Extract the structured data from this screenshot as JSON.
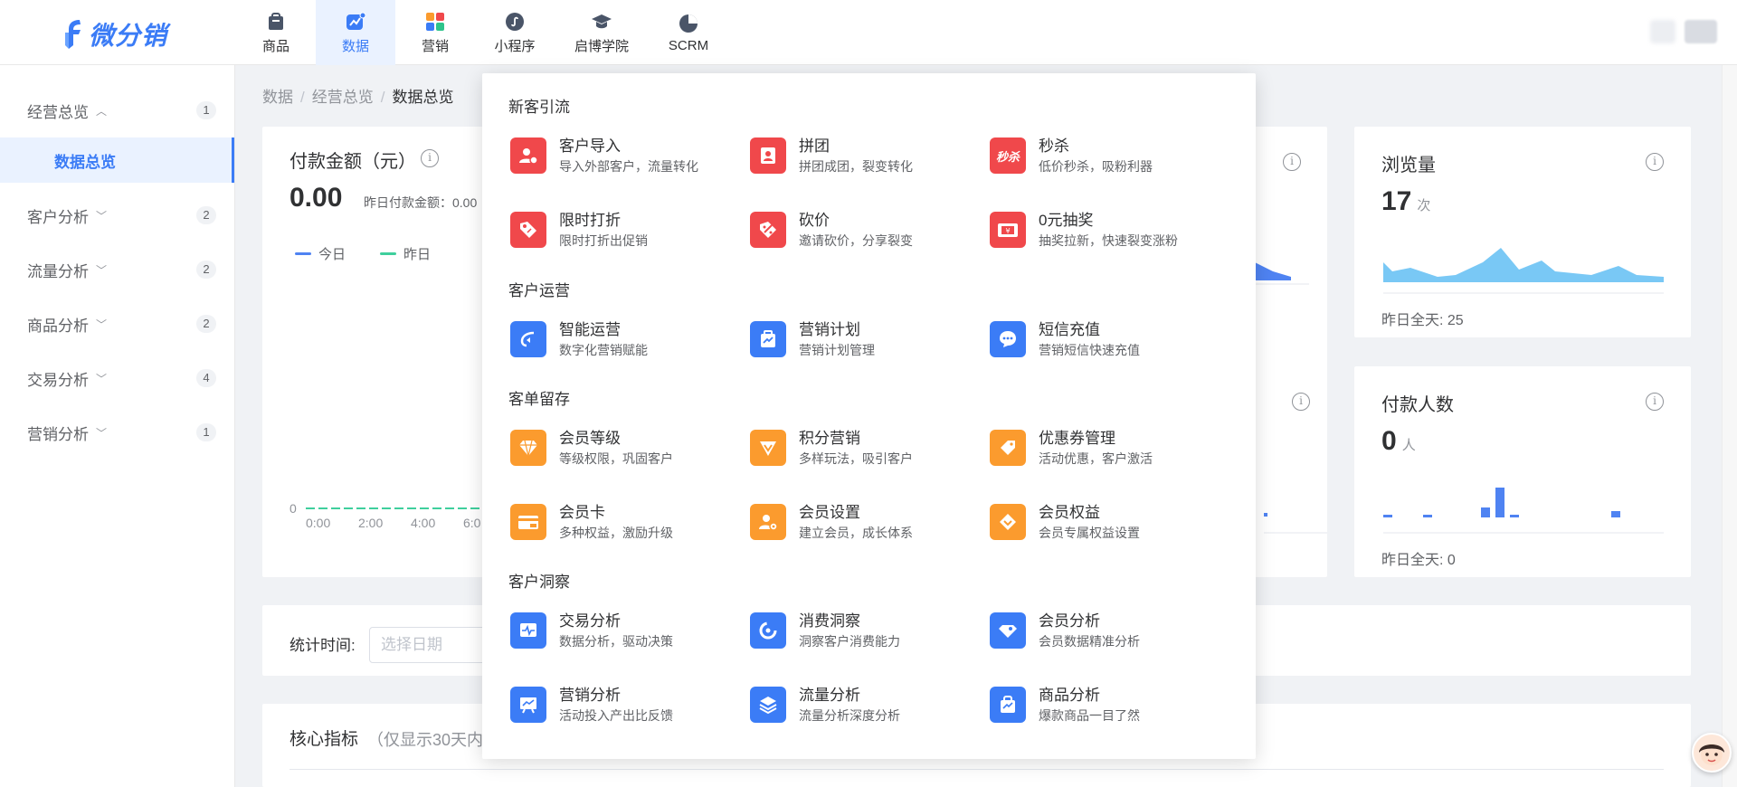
{
  "app": {
    "logo_text": "微分销"
  },
  "topnav": [
    {
      "label": "商品",
      "icon": "bag-icon"
    },
    {
      "label": "数据",
      "icon": "data-chart-icon"
    },
    {
      "label": "营销",
      "icon": "grid-apps-icon"
    },
    {
      "label": "小程序",
      "icon": "mini-program-icon"
    },
    {
      "label": "启博学院",
      "icon": "graduation-cap-icon"
    },
    {
      "label": "SCRM",
      "icon": "pie-icon"
    }
  ],
  "sidebar": {
    "groups": [
      {
        "label": "经营总览",
        "count": "1",
        "expanded": true
      },
      {
        "label": "客户分析",
        "count": "2"
      },
      {
        "label": "流量分析",
        "count": "2"
      },
      {
        "label": "商品分析",
        "count": "2"
      },
      {
        "label": "交易分析",
        "count": "4"
      },
      {
        "label": "营销分析",
        "count": "1"
      }
    ],
    "active_sub": "数据总览"
  },
  "breadcrumb": [
    "数据",
    "经营总览",
    "数据总览"
  ],
  "pay_card": {
    "title": "付款金额（元）",
    "value": "0.00",
    "yesterday": "昨日付款金额：0.00",
    "legend_today": "今日",
    "legend_yesterday": "昨日",
    "y_zero": "0",
    "x_ticks": [
      "0:00",
      "2:00",
      "4:00",
      "6:0"
    ]
  },
  "views_card": {
    "title": "浏览量",
    "value": "17",
    "unit": "次",
    "yesterday": "昨日全天:  25"
  },
  "payers_card": {
    "title": "付款人数",
    "value": "0",
    "unit": "人",
    "yesterday": "昨日全天:  0"
  },
  "stats_time": {
    "label": "统计时间:",
    "placeholder": "选择日期"
  },
  "core": {
    "title": "核心指标",
    "note": "（仅显示30天内"
  },
  "dropdown": {
    "sections": [
      {
        "title": "新客引流",
        "items": [
          {
            "name": "客户导入",
            "desc": "导入外部客户，流量转化",
            "icon": "customer-import-icon",
            "color": "#f0484b"
          },
          {
            "name": "拼团",
            "desc": "拼团成团，裂变转化",
            "icon": "group-buy-icon",
            "color": "#f0484b"
          },
          {
            "name": "秒杀",
            "desc": "低价秒杀，吸粉利器",
            "icon": "flash-sale-icon",
            "color": "#f0484b",
            "icon_text": "秒杀"
          },
          {
            "name": "限时打折",
            "desc": "限时打折出促销",
            "icon": "discount-tag-icon",
            "color": "#f0484b"
          },
          {
            "name": "砍价",
            "desc": "邀请砍价，分享裂变",
            "icon": "bargain-icon",
            "color": "#f0484b"
          },
          {
            "name": "0元抽奖",
            "desc": "抽奖拉新，快速裂变涨粉",
            "icon": "lottery-icon",
            "color": "#f0484b"
          }
        ]
      },
      {
        "title": "客户运营",
        "items": [
          {
            "name": "智能运营",
            "desc": "数字化营销赋能",
            "icon": "smart-ops-icon",
            "color": "#3b7cf6"
          },
          {
            "name": "营销计划",
            "desc": "营销计划管理",
            "icon": "marketing-plan-icon",
            "color": "#3b7cf6"
          },
          {
            "name": "短信充值",
            "desc": "营销短信快速充值",
            "icon": "sms-icon",
            "color": "#3b7cf6"
          }
        ]
      },
      {
        "title": "客单留存",
        "items": [
          {
            "name": "会员等级",
            "desc": "等级权限，巩固客户",
            "icon": "diamond-icon",
            "color": "#fb9b2e"
          },
          {
            "name": "积分营销",
            "desc": "多样玩法，吸引客户",
            "icon": "points-icon",
            "color": "#fb9b2e"
          },
          {
            "name": "优惠券管理",
            "desc": "活动优惠，客户激活",
            "icon": "coupon-icon",
            "color": "#fb9b2e"
          },
          {
            "name": "会员卡",
            "desc": "多种权益，激励升级",
            "icon": "vip-card-icon",
            "color": "#fb9b2e"
          },
          {
            "name": "会员设置",
            "desc": "建立会员，成长体系",
            "icon": "member-settings-icon",
            "color": "#fb9b2e"
          },
          {
            "name": "会员权益",
            "desc": "会员专属权益设置",
            "icon": "member-rights-icon",
            "color": "#fb9b2e"
          }
        ]
      },
      {
        "title": "客户洞察",
        "items": [
          {
            "name": "交易分析",
            "desc": "数据分析，驱动决策",
            "icon": "trade-analysis-icon",
            "color": "#3b7cf6"
          },
          {
            "name": "消费洞察",
            "desc": "洞察客户消费能力",
            "icon": "consumption-icon",
            "color": "#3b7cf6"
          },
          {
            "name": "会员分析",
            "desc": "会员数据精准分析",
            "icon": "member-analysis-icon",
            "color": "#3b7cf6"
          },
          {
            "name": "营销分析",
            "desc": "活动投入产出比反馈",
            "icon": "marketing-analysis-icon",
            "color": "#3b7cf6"
          },
          {
            "name": "流量分析",
            "desc": "流量分析深度分析",
            "icon": "traffic-layers-icon",
            "color": "#3b7cf6"
          },
          {
            "name": "商品分析",
            "desc": "爆款商品一目了然",
            "icon": "product-analysis-icon",
            "color": "#3b7cf6"
          }
        ]
      }
    ]
  }
}
